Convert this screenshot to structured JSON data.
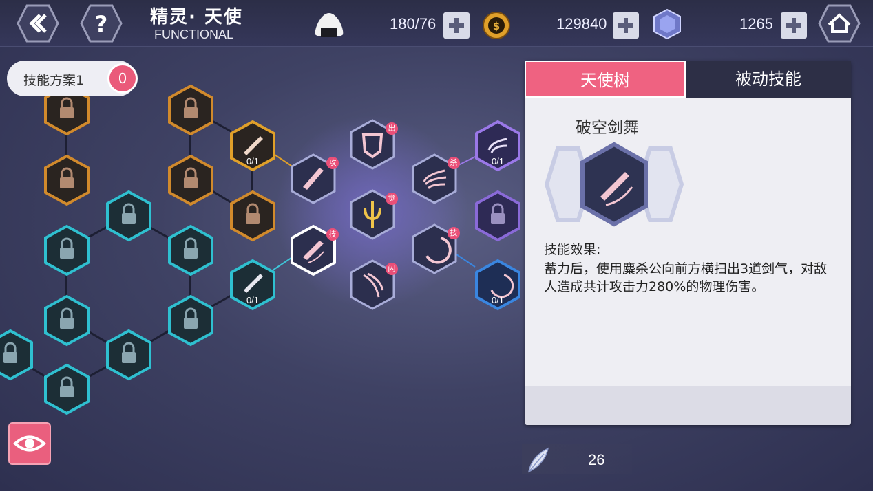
{
  "header": {
    "title_cn": "精灵· 天使",
    "title_en": "FUNCTIONAL",
    "stamina": "180/76",
    "gold": "129840",
    "crystal": "1265"
  },
  "plan": {
    "label": "技能方案1",
    "count": "0"
  },
  "tree": {
    "levels": {
      "ex_sword": "0/1",
      "ex_slash": "0/1",
      "ex_wave": "0/1",
      "ex_arc": "0/1"
    },
    "badges": {
      "attack": "攻",
      "out": "出",
      "kill": "杀",
      "awaken": "觉",
      "skill1": "技",
      "skill2": "技",
      "flash": "闪"
    }
  },
  "panel": {
    "tab_active": "天使树",
    "tab_inactive": "被动技能",
    "skill_name": "破空剑舞",
    "effect_label": "技能效果:",
    "effect_text": "蓄力后，使用麋杀公向前方横扫出3道剑气，对敌人造成共计攻击力280%的物理伤害。"
  },
  "feather": {
    "value": "26"
  },
  "colors": {
    "accent": "#ef6281",
    "orange": "#d18a2c",
    "cyan": "#2fc0d0",
    "purple": "#8a6ad8",
    "blue": "#3a86e0"
  }
}
